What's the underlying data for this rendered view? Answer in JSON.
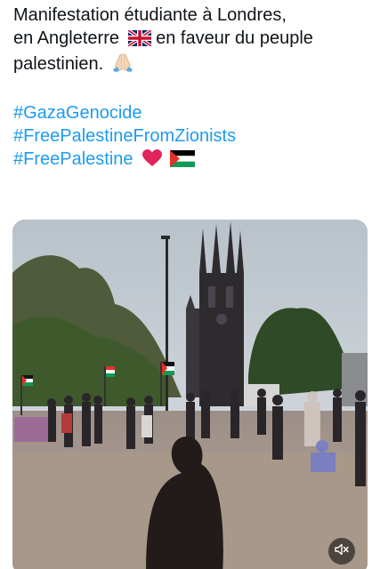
{
  "tweet": {
    "line1": "Manifestation étudiante à Londres,",
    "line2_before_flag": "en Angleterre",
    "line2_after_flag": "en faveur du peuple",
    "line3": "palestinien.",
    "hashtags": [
      "#GazaGenocide",
      "#FreePalestineFromZionists",
      "#FreePalestine"
    ]
  },
  "icons": {
    "uk_flag": "uk-flag-icon",
    "pray": "folded-hands-icon",
    "heart": "red-heart-icon",
    "ps_flag": "palestine-flag-icon",
    "mute": "speaker-muted-icon"
  },
  "colors": {
    "hashtag": "#1d9bf0",
    "text": "#0f1419",
    "heart": "#e0245e"
  }
}
